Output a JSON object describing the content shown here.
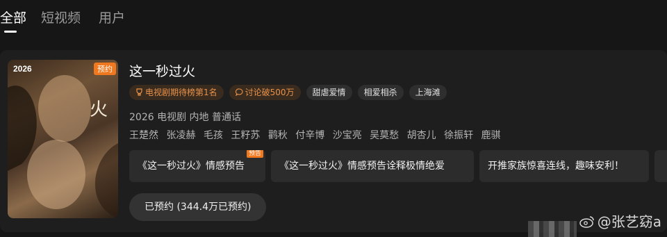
{
  "tabs": [
    {
      "label": "全部",
      "active": true
    },
    {
      "label": "短视频",
      "active": false
    },
    {
      "label": "用户",
      "active": false
    }
  ],
  "poster": {
    "year": "2026",
    "badge": "预约"
  },
  "show": {
    "title": "这一秒过火",
    "tags": [
      {
        "label": "电视剧期待榜第1名",
        "style": "orange",
        "icon": "trophy-icon"
      },
      {
        "label": "讨论破500万",
        "style": "orange",
        "icon": "comment-icon"
      },
      {
        "label": "甜虐爱情",
        "style": "gray"
      },
      {
        "label": "相爱相杀",
        "style": "gray"
      },
      {
        "label": "上海滩",
        "style": "gray"
      }
    ],
    "meta": "2026 电视剧 内地 普通话",
    "cast": [
      "王楚然",
      "张凌赫",
      "毛孩",
      "王籽苏",
      "鹳秋",
      "付辛博",
      "沙宝亮",
      "吴莫愁",
      "胡杏儿",
      "徐振轩",
      "鹿骐"
    ]
  },
  "videos": [
    {
      "label": "《这一秒过火》情感预告",
      "badge": "预告"
    },
    {
      "label": "《这一秒过火》情感预告诠释极情绝爱"
    },
    {
      "label": "开推家族惊喜连线，趣味安利！"
    }
  ],
  "reserve_button": "已预约 (344.4万已预约)",
  "watermark": "@张艺窈a",
  "colors": {
    "background": "#161616",
    "card": "#1e1e1e",
    "accent_orange": "#f0781e",
    "tag_orange_text": "#e8924a"
  }
}
